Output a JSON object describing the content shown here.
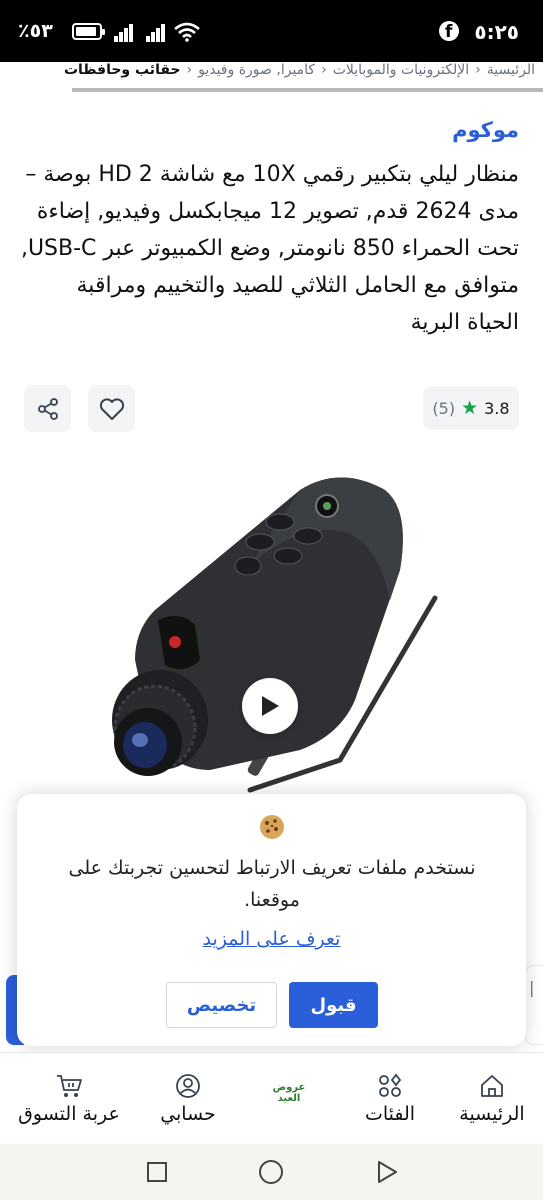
{
  "status_bar": {
    "time": "٥:٢٥",
    "battery_percent": "٪٥٣",
    "icons": [
      "facebook-icon",
      "battery-icon",
      "signal-icon",
      "signal-icon",
      "wifi-icon"
    ]
  },
  "breadcrumb": {
    "items": [
      "الرئيسية",
      "الإلكترونيات والموبايلات",
      "كاميرا, صورة وفيديو",
      "حقائب وحافظات"
    ],
    "separator": "‹"
  },
  "product": {
    "brand": "موكوم",
    "title": "منظار ليلي بتكبير رقمي 10X مع شاشة HD 2 بوصة – مدى 2624 قدم, تصوير 12 ميجابكسل وفيديو, إضاءة تحت الحمراء 850 نانومتر, وضع الكمبيوتر عبر USB-C, متوافق مع الحامل الثلاثي للصيد والتخييم ومراقبة الحياة البرية",
    "rating": "3.8",
    "review_count": "(5)"
  },
  "cookie_banner": {
    "message": "نستخدم ملفات تعريف الارتباط لتحسين تجربتك على موقعنا.",
    "learn_more": "تعرف على المزيد",
    "accept_label": "قبول",
    "customize_label": "تخصيص"
  },
  "bottom_nav": {
    "home": "الرئيسية",
    "categories": "الفئات",
    "eid_offers": "عروض العيد",
    "account": "حسابي",
    "cart": "عربة التسوق"
  },
  "colors": {
    "accent": "#2b5fd9",
    "star": "#16a34a",
    "eid": "#2e7d32"
  }
}
